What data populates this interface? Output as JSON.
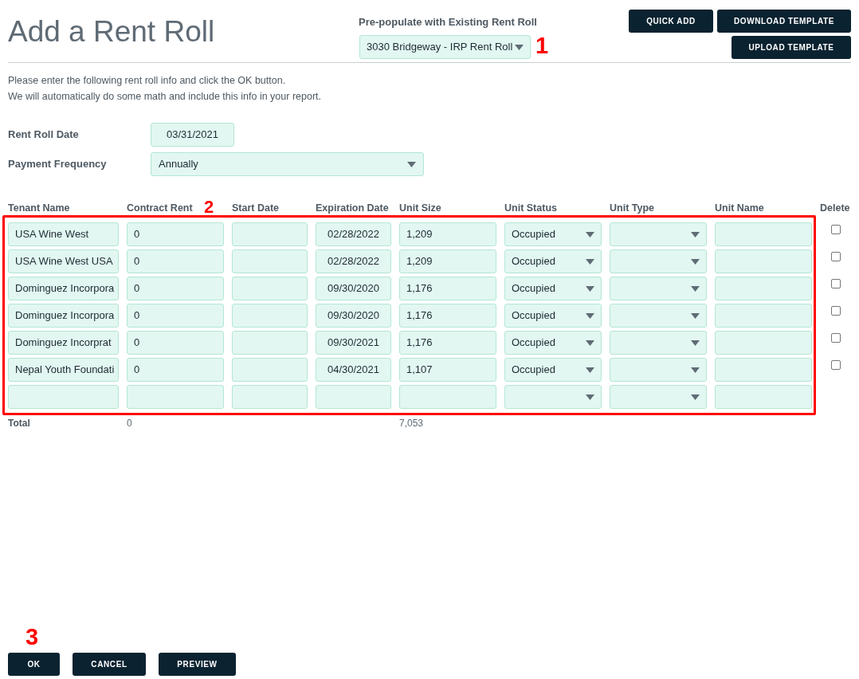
{
  "header": {
    "title": "Add a Rent Roll",
    "prepopulate": {
      "label": "Pre-populate with Existing Rent Roll",
      "value": "3030 Bridgeway - IRP Rent Roll"
    },
    "buttons": [
      {
        "label": "QUICK ADD",
        "kind": "top"
      },
      {
        "label": "DOWNLOAD TEMPLATE",
        "kind": "top"
      },
      {
        "label": "UPLOAD TEMPLATE",
        "kind": "second"
      }
    ]
  },
  "instructions": [
    "Please enter the following rent roll info and click the OK button.",
    "We will automatically do some math and include this info in your report."
  ],
  "fields": [
    {
      "label": "Rent Roll Date",
      "kind": "date",
      "value": "03/31/2021"
    },
    {
      "label": "Payment Frequency",
      "kind": "select",
      "value": "Annually"
    }
  ],
  "table": {
    "columns": [
      {
        "label": "Tenant Name",
        "kind": "text"
      },
      {
        "label": "Contract Rent",
        "kind": "text"
      },
      {
        "label": "Start Date",
        "kind": "date"
      },
      {
        "label": "Expiration Date",
        "kind": "date"
      },
      {
        "label": "Unit Size",
        "kind": "text"
      },
      {
        "label": "Unit Status",
        "kind": "select"
      },
      {
        "label": "Unit Type",
        "kind": "select"
      },
      {
        "label": "Unit Name",
        "kind": "text"
      },
      {
        "label": "Delete",
        "kind": "checkbox"
      }
    ],
    "rows": [
      {
        "kind": "tenant",
        "tenant_name": "USA Wine West",
        "contract_rent": "0",
        "expiration_date": "02/28/2022",
        "unit_size": "1,209",
        "unit_status": "Occupied",
        "delete": false
      },
      {
        "kind": "tenant",
        "tenant_name": "USA Wine West USA",
        "contract_rent": "0",
        "expiration_date": "02/28/2022",
        "unit_size": "1,209",
        "unit_status": "Occupied",
        "delete": false
      },
      {
        "kind": "tenant",
        "tenant_name": "Dominguez Incorpora",
        "contract_rent": "0",
        "expiration_date": "09/30/2020",
        "unit_size": "1,176",
        "unit_status": "Occupied",
        "delete": false
      },
      {
        "kind": "tenant",
        "tenant_name": "Dominguez Incorpora",
        "contract_rent": "0",
        "expiration_date": "09/30/2020",
        "unit_size": "1,176",
        "unit_status": "Occupied",
        "delete": false
      },
      {
        "kind": "tenant",
        "tenant_name": "Dominguez Incorprat",
        "contract_rent": "0",
        "expiration_date": "09/30/2021",
        "unit_size": "1,176",
        "unit_status": "Occupied",
        "delete": false
      },
      {
        "kind": "tenant",
        "tenant_name": "Nepal Youth Foundati",
        "contract_rent": "0",
        "expiration_date": "04/30/2021",
        "unit_size": "1,107",
        "unit_status": "Occupied",
        "delete": false
      },
      {
        "kind": "new"
      }
    ],
    "totals": {
      "label": "Total",
      "contract_rent": "0",
      "unit_size": "7,053"
    }
  },
  "actions": [
    "OK",
    "CANCEL",
    "PREVIEW"
  ],
  "annotations": [
    "1",
    "2",
    "3"
  ]
}
